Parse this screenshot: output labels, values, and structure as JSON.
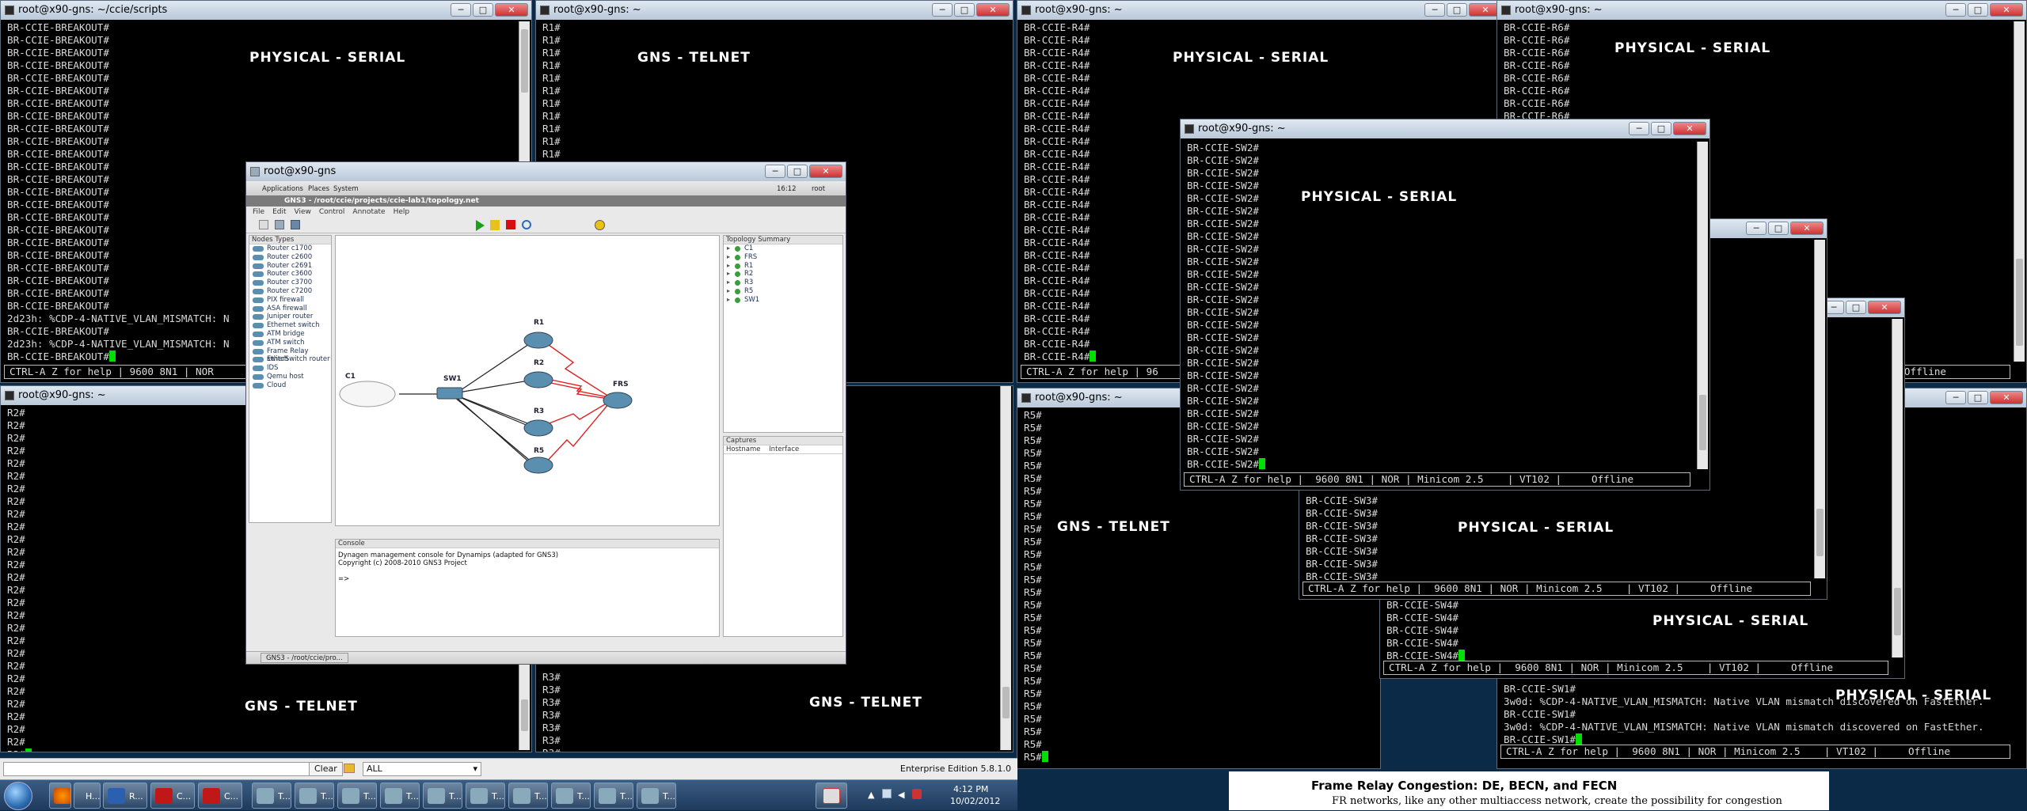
{
  "windows": {
    "w1": {
      "title": "root@x90-gns: ~/ccie/scripts",
      "label": "PHYSICAL - SERIAL",
      "lines": [
        "BR-CCIE-BREAKOUT#",
        "BR-CCIE-BREAKOUT#",
        "BR-CCIE-BREAKOUT#",
        "BR-CCIE-BREAKOUT#",
        "BR-CCIE-BREAKOUT#",
        "BR-CCIE-BREAKOUT#",
        "BR-CCIE-BREAKOUT#",
        "BR-CCIE-BREAKOUT#",
        "BR-CCIE-BREAKOUT#",
        "BR-CCIE-BREAKOUT#",
        "BR-CCIE-BREAKOUT#",
        "BR-CCIE-BREAKOUT#",
        "BR-CCIE-BREAKOUT#",
        "BR-CCIE-BREAKOUT#",
        "BR-CCIE-BREAKOUT#",
        "BR-CCIE-BREAKOUT#",
        "BR-CCIE-BREAKOUT#",
        "BR-CCIE-BREAKOUT#",
        "BR-CCIE-BREAKOUT#",
        "BR-CCIE-BREAKOUT#",
        "BR-CCIE-BREAKOUT#",
        "BR-CCIE-BREAKOUT#",
        "BR-CCIE-BREAKOUT#",
        "2d23h: %CDP-4-NATIVE_VLAN_MISMATCH: N",
        "BR-CCIE-BREAKOUT#",
        "2d23h: %CDP-4-NATIVE_VLAN_MISMATCH: N",
        "BR-CCIE-BREAKOUT#"
      ],
      "status": "CTRL-A Z for help | 9600 8N1 | NOR"
    },
    "w2": {
      "title": "root@x90-gns: ~",
      "label": "GNS - TELNET",
      "lines": [
        "R1#",
        "R1#",
        "R1#",
        "R1#",
        "R1#",
        "R1#",
        "R1#",
        "R1#",
        "R1#",
        "R1#",
        "R1#",
        "R1#"
      ]
    },
    "w3": {
      "title": "root@x90-gns: ~",
      "label": "GNS - TELNET",
      "prompt": "R2#",
      "count": 28
    },
    "w4": {
      "title": "",
      "label": "GNS - TELNET",
      "prompt": "R3#",
      "count": 8
    },
    "w5": {
      "title": "root@x90-gns: ~",
      "label": "PHYSICAL - SERIAL",
      "prompt": "BR-CCIE-R4#",
      "count": 27,
      "status": "CTRL-A Z for help | 96"
    },
    "w6": {
      "title": "root@x90-gns: ~",
      "label": "PHYSICAL - SERIAL",
      "prompt": "BR-CCIE-R6#",
      "count": 8,
      "status": "Offline"
    },
    "w7": {
      "title": "root@x90-gns: ~",
      "label": "GNS - TELNET",
      "prompt": "R5#",
      "count": 28
    },
    "w8": {
      "title": "root@x90-gns: ~",
      "label": "PHYSICAL - SERIAL",
      "prompt": "BR-CCIE-SW2#",
      "count": 26,
      "status": "CTRL-A Z for help |  9600 8N1 | NOR | Minicom 2.5    | VT102 |     Offline"
    },
    "w9": {
      "title": "",
      "label": "PHYSICAL - SERIAL",
      "prompt": "BR-CCIE-SW3#",
      "count": 8,
      "status": "CTRL-A Z for help |  9600 8N1 | NOR | Minicom 2.5    | VT102 |     Offline"
    },
    "w10": {
      "title": "",
      "label": "PHYSICAL - SERIAL",
      "prompt": "BR-CCIE-SW4#",
      "count": 5,
      "status": "CTRL-A Z for help |  9600 8N1 | NOR | Minicom 2.5    | VT102 |     Offline"
    },
    "w11": {
      "title": "",
      "label": "PHYSICAL - SERIAL",
      "lines": [
        "BR-CCIE-SW1#",
        "3w0d: %CDP-4-NATIVE_VLAN_MISMATCH: Native VLAN mismatch discovered on FastEther.",
        "BR-CCIE-SW1#",
        "3w0d: %CDP-4-NATIVE_VLAN_MISMATCH: Native VLAN mismatch discovered on FastEther.",
        "BR-CCIE-SW1#"
      ],
      "status": "CTRL-A Z for help |  9600 8N1 | NOR | Minicom 2.5    | VT102 |     Offline"
    }
  },
  "gns3": {
    "vnc_title": "root@x90-gns",
    "panel": {
      "menu": [
        "Applications",
        "Places",
        "System"
      ],
      "clock": "16:12",
      "user": "root"
    },
    "window_title": "GNS3 - /root/ccie/projects/ccie-lab1/topology.net",
    "menu": [
      "File",
      "Edit",
      "View",
      "Control",
      "Annotate",
      "Help"
    ],
    "node_types_title": "Nodes Types",
    "node_types": [
      "Router c1700",
      "Router c2600",
      "Router c2691",
      "Router c3600",
      "Router c3700",
      "Router c7200",
      "PIX firewall",
      "ASA firewall",
      "Juniper router",
      "Ethernet switch",
      "ATM bridge",
      "ATM switch",
      "Frame Relay switch",
      "EtherSwitch router",
      "IDS",
      "Qemu host",
      "Cloud"
    ],
    "topology_title": "Topology Summary",
    "topology": [
      "C1",
      "FRS",
      "R1",
      "R2",
      "R3",
      "R5",
      "SW1"
    ],
    "captures_title": "Captures",
    "captures_cols": [
      "Hostname",
      "Interface"
    ],
    "console_title": "Console",
    "console_lines": [
      "Dynagen management console for Dynamips (adapted for GNS3)",
      "Copyright (c) 2008-2010 GNS3 Project",
      "",
      "=>"
    ],
    "devices": {
      "c1": "C1",
      "sw1": "SW1",
      "r1": "R1",
      "r2": "R2",
      "r3": "R3",
      "r5": "R5",
      "frs": "FRS"
    },
    "taskbar_item": "GNS3 - /root/ccie/pro..."
  },
  "quickbar": {
    "clear": "Clear",
    "filter": "ALL",
    "edition": "Enterprise Edition 5.8.1.0"
  },
  "taskbar": {
    "time": "4:12 PM",
    "date": "10/02/2012",
    "items": [
      "H...",
      "R...",
      "C...",
      "C...",
      "T...",
      "T...",
      "T...",
      "T...",
      "T...",
      "T...",
      "T...",
      "T...",
      "T...",
      "T..."
    ]
  },
  "pdf": {
    "title": "Frame Relay Congestion: DE, BECN, and FECN",
    "text": "FR networks, like any other multiaccess network, create the possibility for congestion"
  }
}
